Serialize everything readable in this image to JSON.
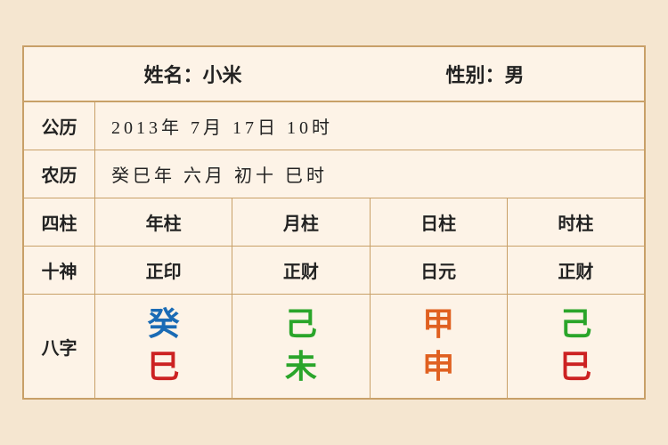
{
  "header": {
    "name_label": "姓名：小米",
    "gender_label": "性别：男"
  },
  "solar": {
    "label": "公历",
    "value": "2013年 7月 17日 10时"
  },
  "lunar": {
    "label": "农历",
    "value": "癸巳年 六月 初十 巳时"
  },
  "sijhu_row": {
    "label": "四柱",
    "cols": [
      "年柱",
      "月柱",
      "日柱",
      "时柱"
    ]
  },
  "shishen_row": {
    "label": "十神",
    "cols": [
      "正印",
      "正财",
      "日元",
      "正财"
    ]
  },
  "bazhi": {
    "label": "八字",
    "columns": [
      {
        "top": "癸",
        "top_color": "color-blue",
        "bottom": "巳",
        "bottom_color": "color-red"
      },
      {
        "top": "己",
        "top_color": "color-green",
        "bottom": "未",
        "bottom_color": "color-green2"
      },
      {
        "top": "甲",
        "top_color": "color-orange",
        "bottom": "申",
        "bottom_color": "color-orange2"
      },
      {
        "top": "己",
        "top_color": "color-green",
        "bottom": "巳",
        "bottom_color": "color-red2"
      }
    ]
  }
}
